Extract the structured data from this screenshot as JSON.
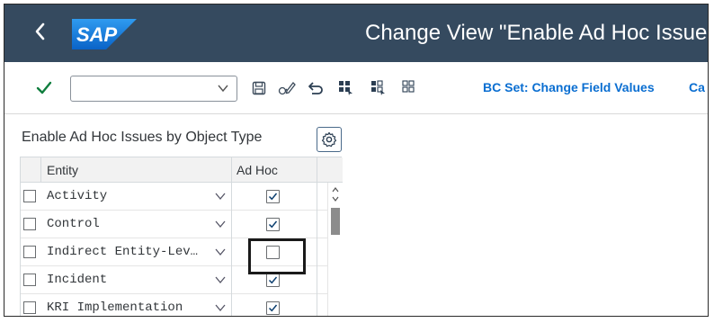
{
  "shell": {
    "title": "Change View \"Enable Ad Hoc Issues",
    "logo_text": "SAP",
    "back_icon": "chevron-left-icon"
  },
  "toolbar": {
    "command_field": {
      "value": "",
      "placeholder": ""
    },
    "icons": [
      "checkmark-icon",
      "save-icon",
      "display-change-icon",
      "undo-icon",
      "select-all-icon",
      "select-block-icon",
      "deselect-all-icon"
    ],
    "bc_set_label": "BC Set: Change Field Values",
    "overflow_label": "Ca"
  },
  "table": {
    "title": "Enable Ad Hoc Issues by Object Type",
    "columns": {
      "entity": "Entity",
      "adhoc": "Ad Hoc"
    },
    "rows": [
      {
        "entity": "Activity",
        "adhoc": true
      },
      {
        "entity": "Control",
        "adhoc": true
      },
      {
        "entity": "Indirect Entity-Lev…",
        "adhoc": false
      },
      {
        "entity": "Incident",
        "adhoc": true
      },
      {
        "entity": "KRI Implementation",
        "adhoc": true
      }
    ]
  },
  "colors": {
    "shell_bg": "#354a5f",
    "link": "#0a6ed1",
    "check_green": "#107e3e",
    "logo_blue": "#0a7ad8"
  }
}
